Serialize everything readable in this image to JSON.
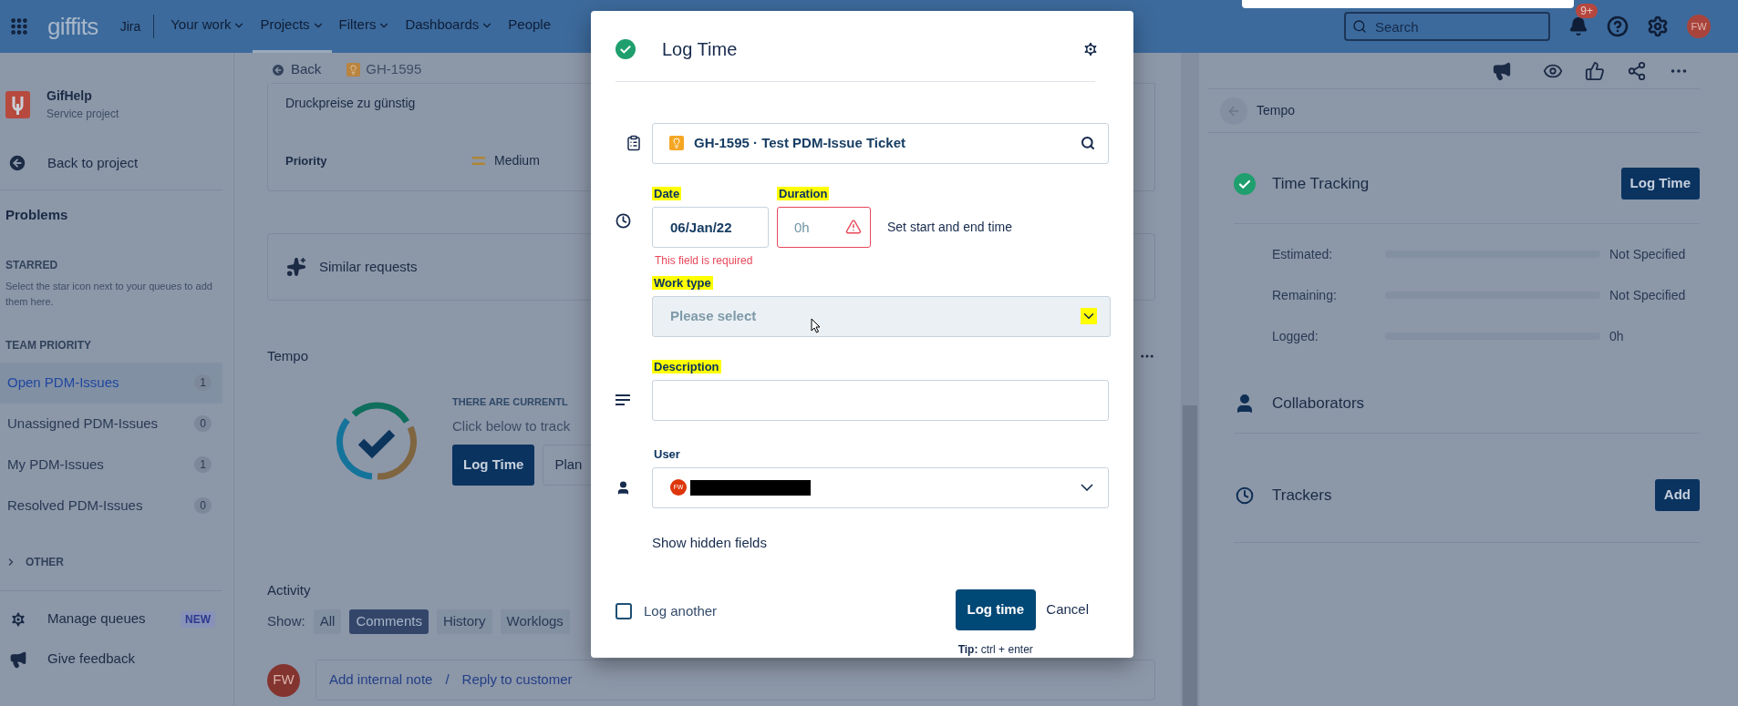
{
  "top_bar": {
    "logo": "giffits",
    "product": "Jira",
    "menus": [
      {
        "label": "Your work",
        "selected": false,
        "caret": true
      },
      {
        "label": "Projects",
        "selected": true,
        "caret": true
      },
      {
        "label": "Filters",
        "selected": false,
        "caret": true
      },
      {
        "label": "Dashboards",
        "selected": false,
        "caret": true
      },
      {
        "label": "People",
        "selected": false,
        "caret": false
      }
    ],
    "search": {
      "placeholder": "Search"
    },
    "notification_badge": "9+",
    "avatar": "FW"
  },
  "sidebar": {
    "project": {
      "name": "GifHelp",
      "type": "Service project"
    },
    "back": "Back to project",
    "heading": "Problems",
    "starred": {
      "title": "STARRED",
      "hint": "Select the star icon next to your queues to add them here."
    },
    "team_priority": {
      "title": "TEAM PRIORITY",
      "queues": [
        {
          "label": "Open PDM-Issues",
          "count": "1",
          "selected": true
        },
        {
          "label": "Unassigned PDM-Issues",
          "count": "0",
          "selected": false
        },
        {
          "label": "My PDM-Issues",
          "count": "1",
          "selected": false
        },
        {
          "label": "Resolved PDM-Issues",
          "count": "0",
          "selected": false
        }
      ]
    },
    "other": "OTHER",
    "footer": [
      {
        "kind": "gear",
        "label": "Manage queues",
        "badge": "NEW"
      },
      {
        "kind": "megaphone",
        "label": "Give feedback"
      }
    ]
  },
  "issue": {
    "back": "Back",
    "key": "GH-1595",
    "summary": "Druckpreise zu günstig",
    "priority": {
      "label": "Priority",
      "value": "Medium"
    },
    "similar": "Similar requests",
    "tempo": {
      "title": "Tempo",
      "headline": "THERE ARE CURRENTL",
      "text": "Click below to track",
      "buttons": [
        {
          "label": "Log Time",
          "primary": true
        },
        {
          "label": "Plan",
          "primary": false
        }
      ]
    },
    "activity": {
      "title": "Activity",
      "show": "Show:",
      "filters": [
        {
          "label": "All",
          "selected": false
        },
        {
          "label": "Comments",
          "selected": true
        },
        {
          "label": "History",
          "selected": false
        },
        {
          "label": "Worklogs",
          "selected": false
        }
      ],
      "avatar": "FW",
      "note": "Add internal note",
      "separator": "/",
      "reply": "Reply to customer"
    }
  },
  "tempo_panel": {
    "title": "Tempo",
    "time_tracking": {
      "title": "Time Tracking",
      "button": "Log Time",
      "rows": [
        {
          "label": "Estimated:",
          "value": "Not Specified"
        },
        {
          "label": "Remaining:",
          "value": "Not Specified"
        },
        {
          "label": "Logged:",
          "value": "0h"
        }
      ]
    },
    "collaborators": "Collaborators",
    "trackers": {
      "title": "Trackers",
      "button": "Add"
    }
  },
  "dialog": {
    "title": "Log Time",
    "issue": "GH-1595 · Test PDM-Issue Ticket",
    "date": {
      "label": "Date",
      "value": "06/Jan/22",
      "highlighted": true
    },
    "duration": {
      "label": "Duration",
      "placeholder": "0h",
      "invalid": true,
      "error": "This field is required",
      "highlighted": true
    },
    "set_time": "Set start and end time",
    "work_type": {
      "label": "Work type",
      "placeholder": "Please select",
      "highlighted": true
    },
    "description": {
      "label": "Description",
      "highlighted": true
    },
    "user": {
      "label": "User",
      "avatar": "FW",
      "highlighted": false
    },
    "show_hidden": "Show hidden fields",
    "log_another": {
      "label": "Log another",
      "checked": false
    },
    "submit": "Log time",
    "cancel": "Cancel",
    "tip": "**Tip:** ctrl + enter"
  }
}
